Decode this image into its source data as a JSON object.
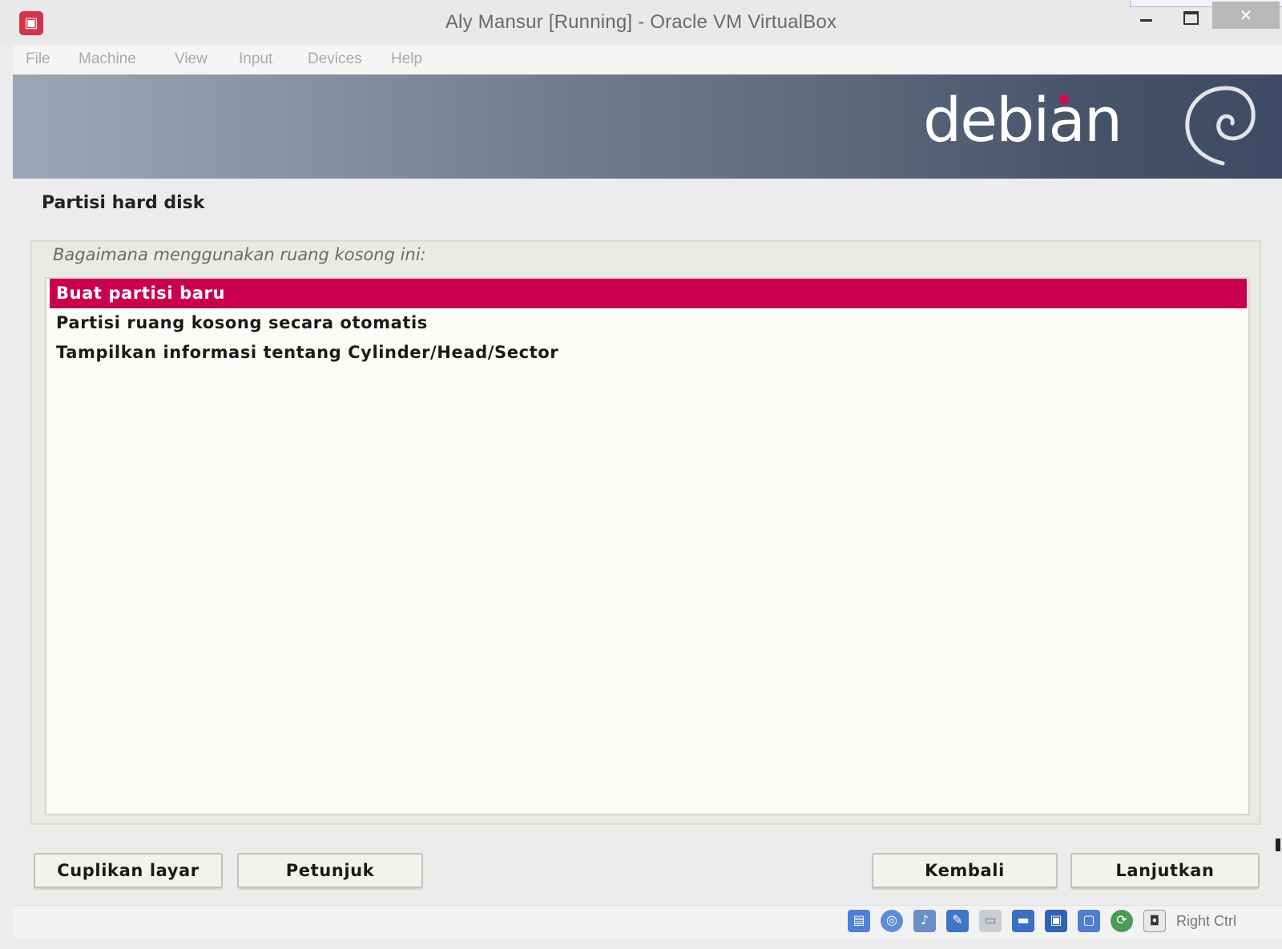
{
  "window": {
    "title": "Aly Mansur [Running] - Oracle VM VirtualBox",
    "icon": "virtualbox-app-icon",
    "controls": [
      "minimize-icon",
      "maximize-icon",
      "close-icon"
    ]
  },
  "menu": {
    "items": [
      "File",
      "Machine",
      "View",
      "Input",
      "Devices",
      "Help"
    ]
  },
  "banner": {
    "wordmark": "debian",
    "logo_icon": "debian-swirl-icon",
    "accent_color": "#d70751"
  },
  "installer": {
    "page_title": "Partisi hard disk",
    "question": "Bagaimana menggunakan ruang kosong ini:",
    "options": [
      {
        "label": "Buat partisi baru",
        "selected": true
      },
      {
        "label": "Partisi ruang kosong secara otomatis",
        "selected": false
      },
      {
        "label": "Tampilkan informasi tentang Cylinder/Head/Sector",
        "selected": false
      }
    ],
    "selection_color": "#c8004f",
    "buttons": {
      "screenshot": "Cuplikan layar",
      "help": "Petunjuk",
      "back": "Kembali",
      "continue": "Lanjutkan"
    }
  },
  "statusbar": {
    "icons": [
      "hard-disk-icon",
      "optical-drive-icon",
      "audio-icon",
      "network-icon",
      "usb-icon",
      "shared-folders-icon",
      "display-icon",
      "video-capture-icon",
      "cpu-icon",
      "guest-additions-icon",
      "mouse-integration-icon"
    ],
    "host_key": "Right Ctrl"
  }
}
